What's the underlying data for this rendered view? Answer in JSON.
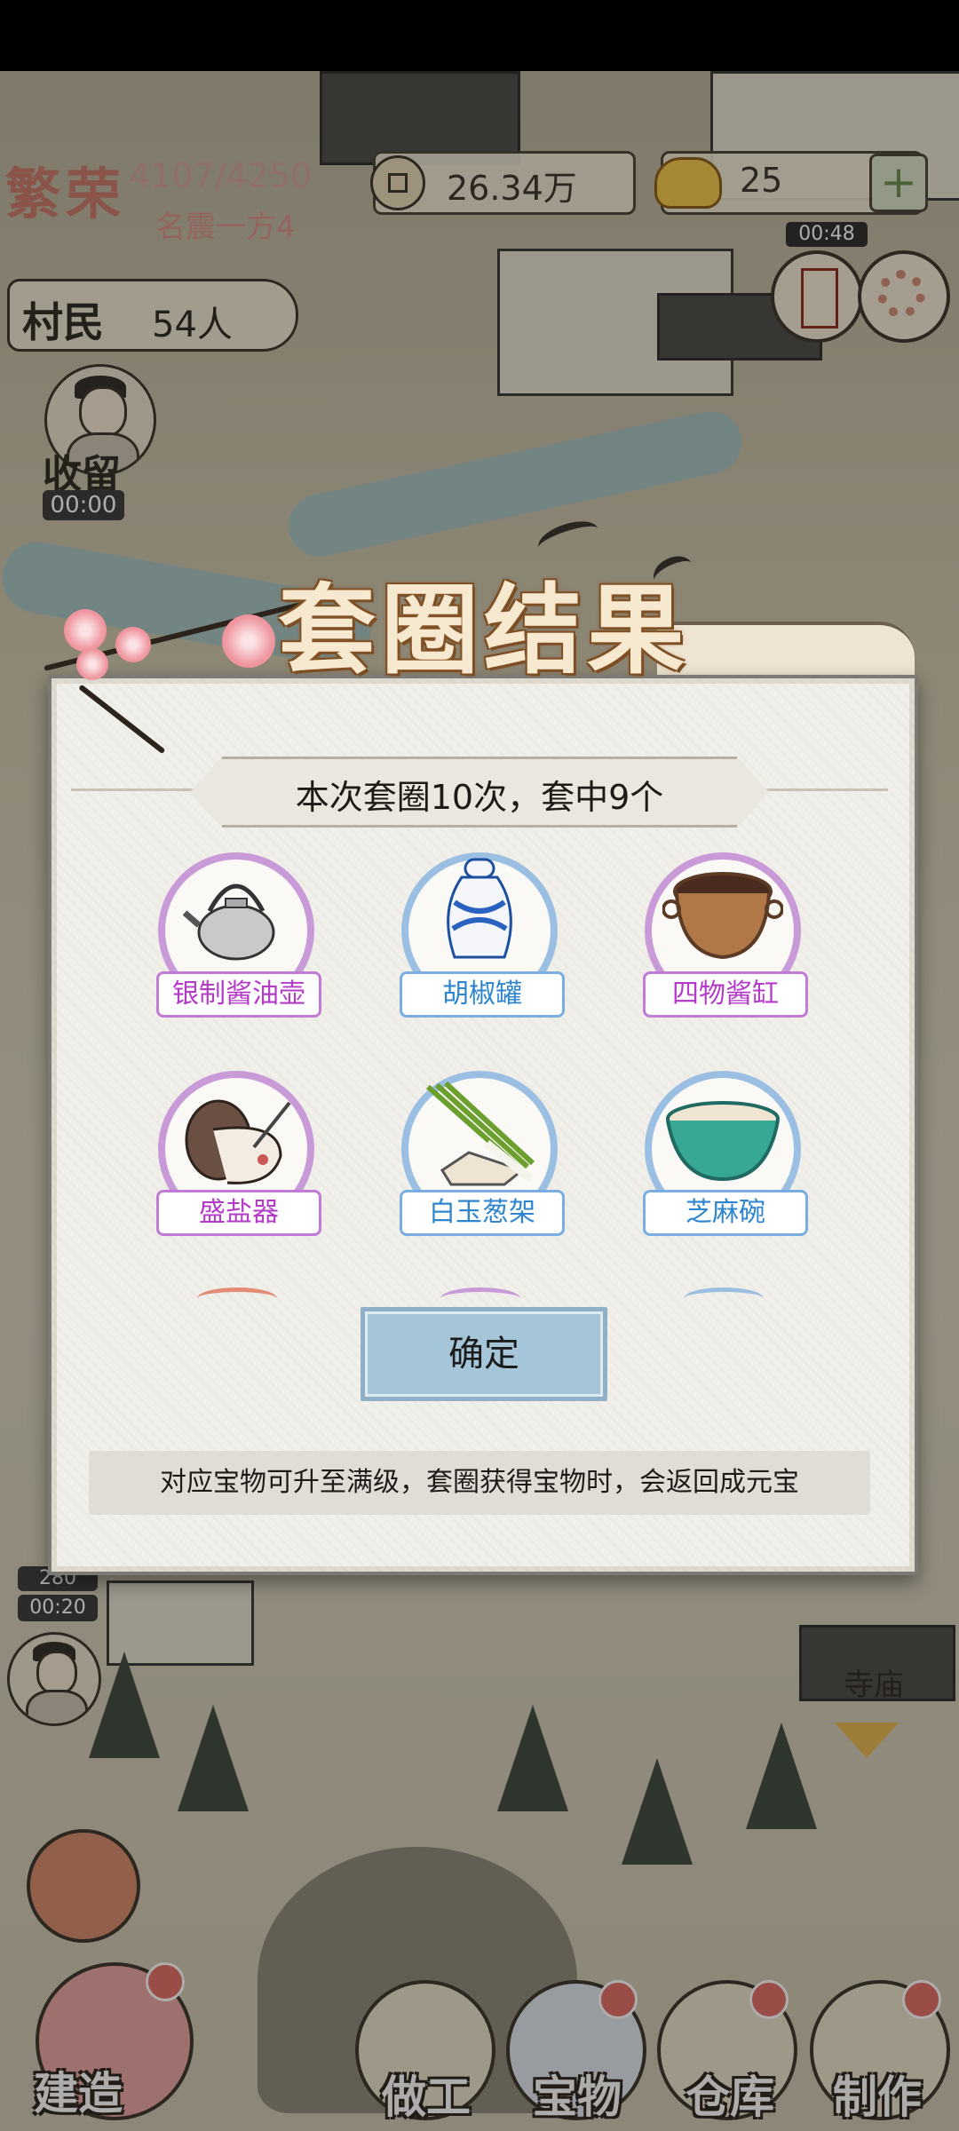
{
  "hud": {
    "prosperity_title": "繁荣",
    "prosperity_value": "4107/4250",
    "prosperity_level": "名震一方4",
    "copper": "26.34万",
    "ingots": "25",
    "add_symbol": "+",
    "event_timer": "00:48",
    "villager_label": "村民",
    "villager_count": "54人",
    "take_in_label": "收留",
    "take_in_timer": "00:00",
    "side_badge": "280",
    "side_timer": "00:20",
    "temple_label": "寺庙"
  },
  "dialog": {
    "title": "套圈结果",
    "summary": "本次套圈10次，套中9个",
    "items": [
      {
        "name": "银制酱油壶",
        "rarity": "purple",
        "icon": "silver-teapot-icon"
      },
      {
        "name": "胡椒罐",
        "rarity": "blue",
        "icon": "blue-white-jar-icon"
      },
      {
        "name": "四物酱缸",
        "rarity": "purple",
        "icon": "sauce-vat-icon"
      },
      {
        "name": "盛盐器",
        "rarity": "purple",
        "icon": "salt-container-icon"
      },
      {
        "name": "白玉葱架",
        "rarity": "blue",
        "icon": "scallion-rack-icon"
      },
      {
        "name": "芝麻碗",
        "rarity": "blue",
        "icon": "sesame-bowl-icon"
      }
    ],
    "confirm": "确定",
    "notice": "对应宝物可升至满级，套圈获得宝物时，会返回成元宝"
  },
  "nav": {
    "build": "建造",
    "work": "做工",
    "treasure": "宝物",
    "warehouse": "仓库",
    "craft": "制作"
  },
  "colors": {
    "purple_rarity": "#c17ad6",
    "blue_rarity": "#7aaee2",
    "confirm_button": "#a5c6d9",
    "badge_red": "#e16d64"
  }
}
